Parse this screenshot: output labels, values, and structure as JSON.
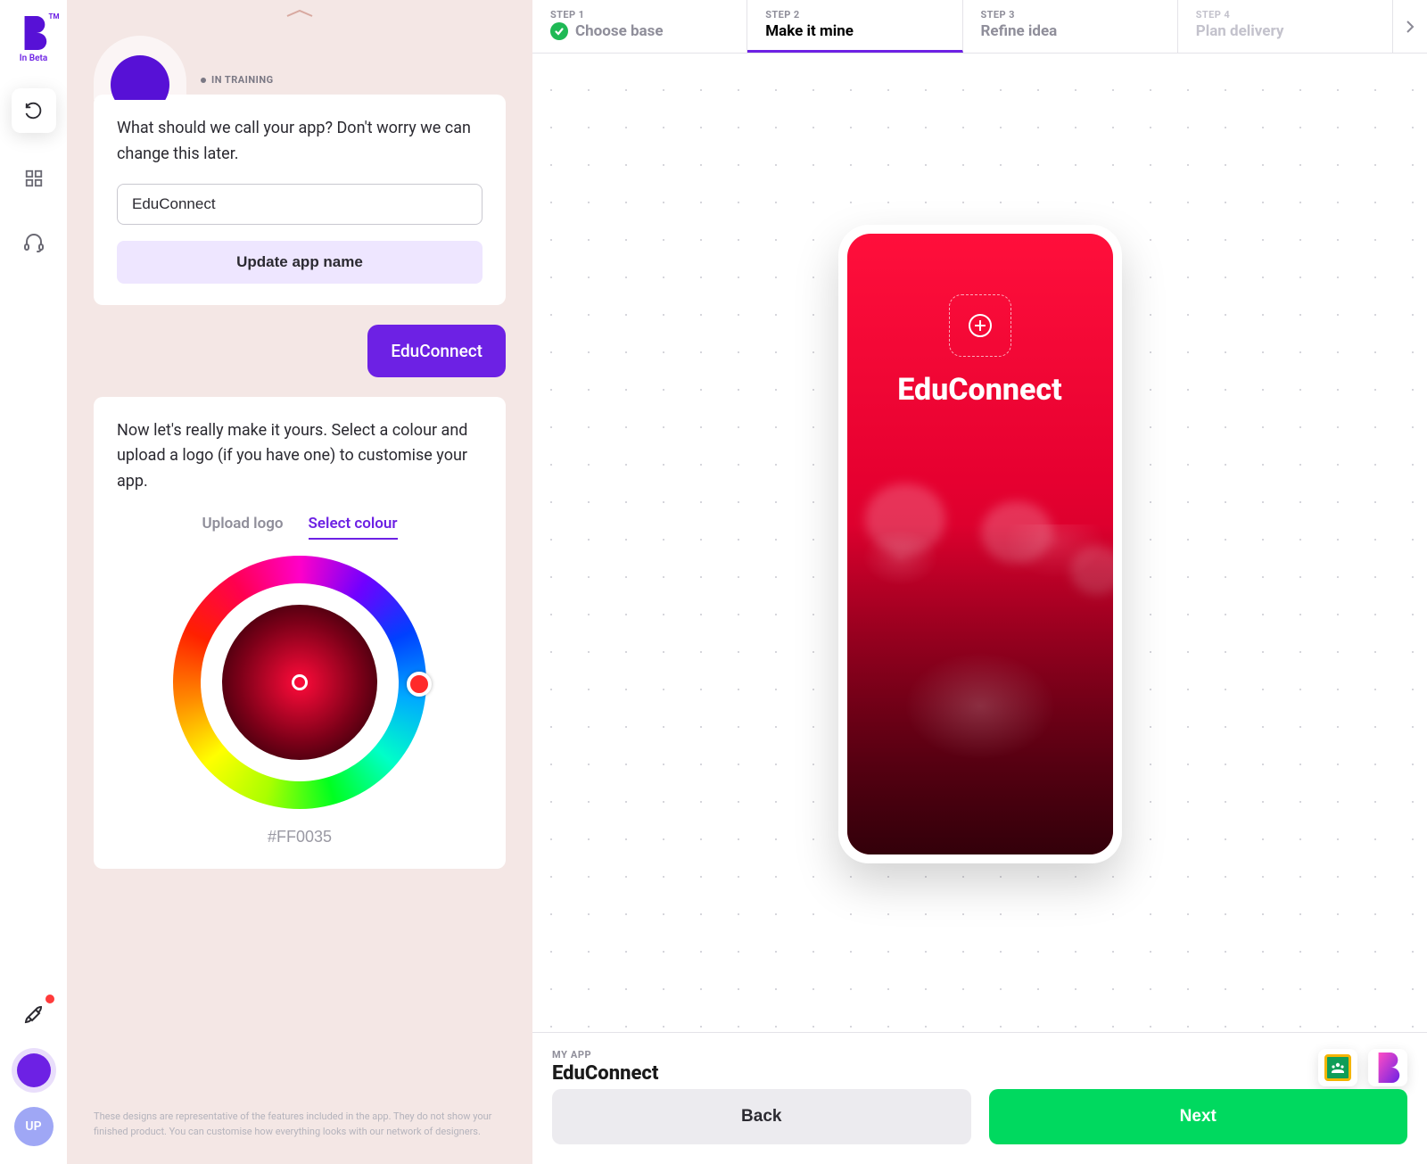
{
  "brand": {
    "beta_label": "In Beta",
    "tm": "TM"
  },
  "sidebar": {
    "user_initials": "UP"
  },
  "chat": {
    "training_badge": "IN TRAINING",
    "name_card": {
      "prompt": "What should we call your app? Don't worry we can change this later.",
      "input_value": "EduConnect",
      "update_label": "Update app name"
    },
    "user_reply": "EduConnect",
    "colour_card": {
      "prompt": "Now let's really make it yours. Select a colour and upload a logo (if you have one) to customise your app.",
      "tab_upload": "Upload logo",
      "tab_colour": "Select colour",
      "hex_value": "#FF0035"
    },
    "disclaimer": "These designs are representative of the features included in the app. They do not show your finished product. You can customise how everything looks with our network of designers."
  },
  "steps": [
    {
      "num": "STEP 1",
      "title": "Choose base",
      "state": "done"
    },
    {
      "num": "STEP 2",
      "title": "Make it mine",
      "state": "active"
    },
    {
      "num": "STEP 3",
      "title": "Refine idea",
      "state": "upcoming"
    },
    {
      "num": "STEP 4",
      "title": "Plan delivery",
      "state": "disabled"
    }
  ],
  "phone": {
    "app_title": "EduConnect"
  },
  "footer": {
    "label": "MY APP",
    "title": "EduConnect",
    "back_label": "Back",
    "next_label": "Next"
  },
  "colors": {
    "accent": "#6D21E4",
    "selected": "#FF0035",
    "next": "#00D95F"
  }
}
